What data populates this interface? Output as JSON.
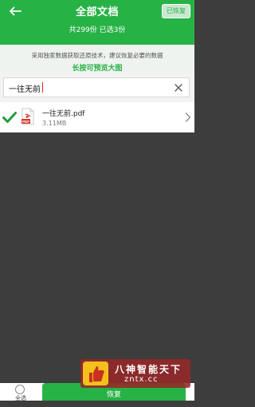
{
  "header": {
    "title": "全部文档",
    "restored_button": "已恢复",
    "counts": "共299份 已选3份"
  },
  "notice": {
    "line1": "采用独家数据获取还原技术，建议恢复必要的数据",
    "line2": "长按可预览大图"
  },
  "search": {
    "value": "一往无前"
  },
  "files": [
    {
      "name": "一往无前.pdf",
      "size": "3.11MB",
      "type_label": "PDF",
      "selected": true
    }
  ],
  "footer": {
    "select_all": "全选",
    "restore": "恢复"
  },
  "watermark": {
    "name": "八神智能天下",
    "url": "zntx.cc"
  },
  "colors": {
    "accent": "#27b245",
    "background": "#3d3d3d"
  }
}
